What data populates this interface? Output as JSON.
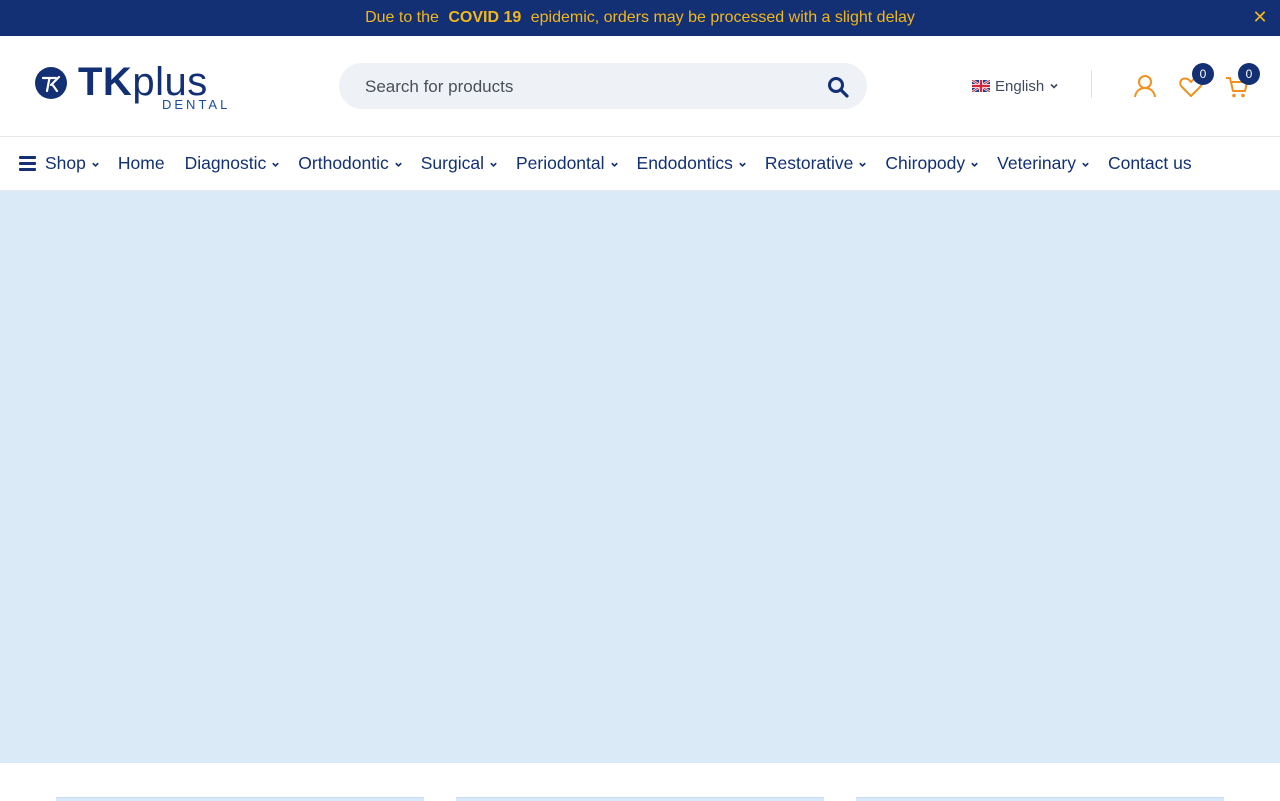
{
  "announcement": {
    "prefix": "Due to the",
    "highlight": "COVID 19",
    "suffix": "epidemic, orders may be processed with a slight delay",
    "close_icon": "close-icon"
  },
  "brand": {
    "name_bold": "TK",
    "name_light": "plus",
    "sub": "DENTAL",
    "primary_color": "#123073",
    "accent_color": "#f3b61b",
    "icon_color": "#f0901e"
  },
  "search": {
    "placeholder": "Search for products",
    "icon": "search-icon"
  },
  "language": {
    "label": "English",
    "flag": "uk-flag-icon"
  },
  "header_icons": {
    "account": "user-icon",
    "wishlist": "heart-icon",
    "wishlist_count": "0",
    "cart": "cart-icon",
    "cart_count": "0"
  },
  "nav": {
    "items": [
      {
        "label": "Shop",
        "has_dropdown": true,
        "icon": "menu-icon"
      },
      {
        "label": "Home",
        "has_dropdown": false
      },
      {
        "label": "Diagnostic",
        "has_dropdown": true
      },
      {
        "label": "Orthodontic",
        "has_dropdown": true
      },
      {
        "label": "Surgical",
        "has_dropdown": true
      },
      {
        "label": "Periodontal",
        "has_dropdown": true
      },
      {
        "label": "Endodontics",
        "has_dropdown": true
      },
      {
        "label": "Restorative",
        "has_dropdown": true
      },
      {
        "label": "Chiropody",
        "has_dropdown": true
      },
      {
        "label": "Veterinary",
        "has_dropdown": true
      },
      {
        "label": "Contact us",
        "has_dropdown": false
      }
    ]
  },
  "hero": {
    "background": "#daeaf7"
  }
}
